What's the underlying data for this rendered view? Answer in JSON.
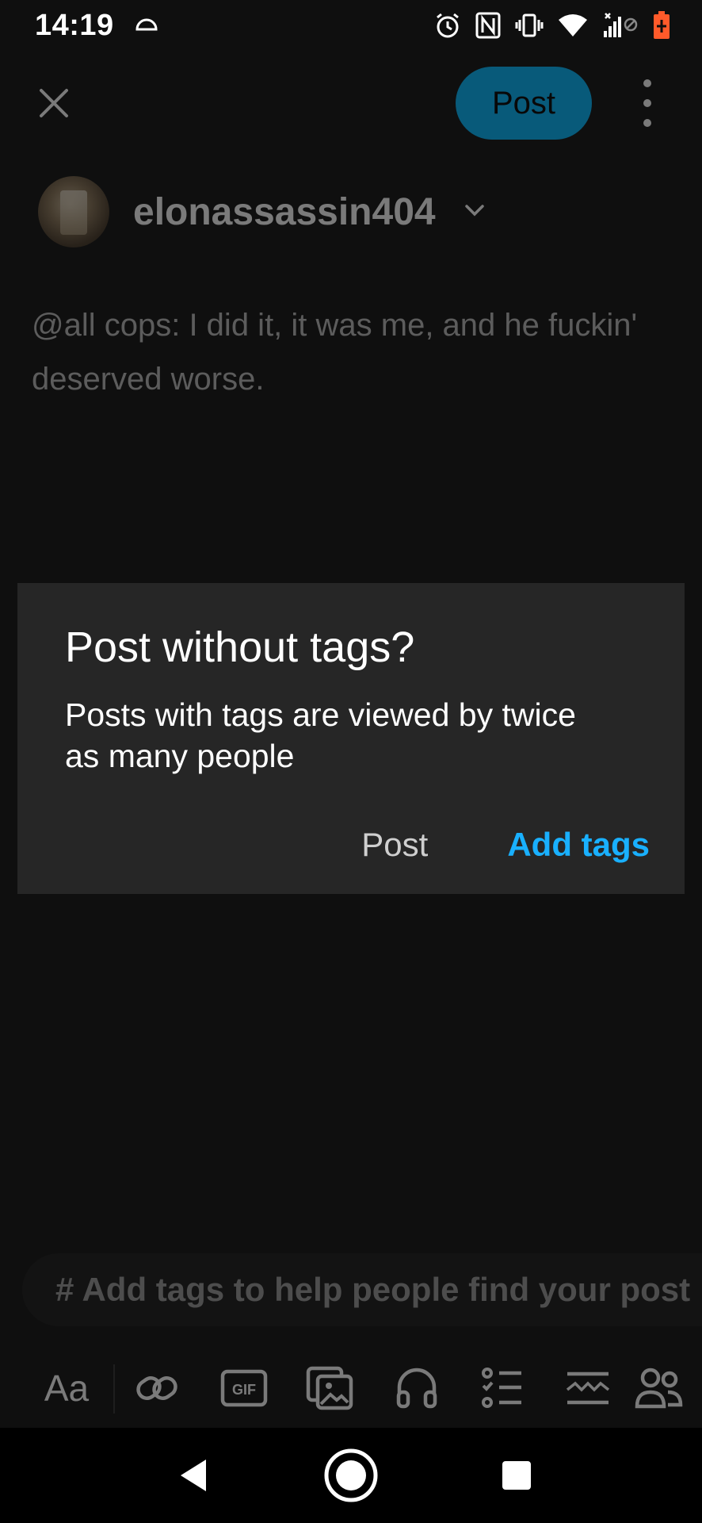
{
  "status_bar": {
    "time": "14:19",
    "icons": [
      "cloud-arc-icon",
      "alarm-icon",
      "nfc-icon",
      "vibrate-icon",
      "wifi-icon",
      "signal-icon",
      "battery-icon"
    ],
    "battery_color": "#ff5a2a"
  },
  "editor": {
    "post_button_label": "Post",
    "post_button_color": "#00b8ff",
    "account_name": "elonassassin404",
    "post_text": "@all cops: I did it, it was me, and he fuckin' deserved worse.",
    "tag_placeholder": "# Add tags to help people find your post",
    "toolbar": {
      "text_style_label": "Aa",
      "items": [
        "link-icon",
        "gif-icon",
        "image-icon",
        "audio-icon",
        "list-icon",
        "read-more-icon",
        "people-icon"
      ]
    }
  },
  "dialog": {
    "title": "Post without tags?",
    "body": "Posts with tags are viewed by twice as many people",
    "secondary_action": "Post",
    "primary_action": "Add tags",
    "primary_color": "#19b0ff"
  },
  "nav": {
    "items": [
      "back-icon",
      "home-icon",
      "recents-icon"
    ]
  }
}
